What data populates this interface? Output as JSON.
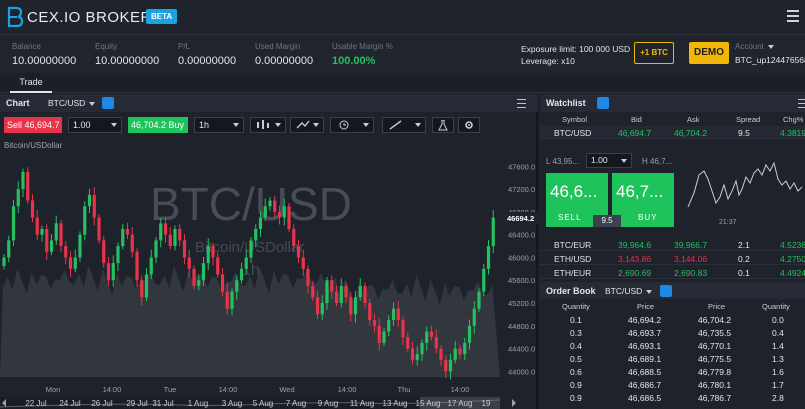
{
  "header": {
    "brand": "CEX.IO BROKER",
    "beta": "BETA"
  },
  "stats": [
    {
      "label": "Balance",
      "value": "10.00000000"
    },
    {
      "label": "Equity",
      "value": "10.00000000"
    },
    {
      "label": "P/L",
      "value": "0.00000000"
    },
    {
      "label": "Used Margin",
      "value": "0.00000000"
    },
    {
      "label": "Usable Margin %",
      "value": "100.00%"
    }
  ],
  "exposure": {
    "limit": "Exposure limit: 100 000 USD",
    "leverage": "Leverage: x10"
  },
  "btn_btc": "+1 BTC",
  "btn_demo": "DEMO",
  "account": {
    "label": "Account",
    "value": "BTC_up124476568"
  },
  "tabs": {
    "trade": "Trade"
  },
  "chart_panel": {
    "title": "Chart",
    "symbol": "BTC/USD",
    "sell": "Sell 46,694.7",
    "qty": "1.00",
    "buy": "46,704.2 Buy",
    "interval": "1h",
    "series_label": "Bitcoin/USDollar",
    "watermark": "BTC/USD",
    "watermark_sub": "Bitcoin/USDollar",
    "watermark_int": "1h"
  },
  "chart_data": {
    "type": "candlestick",
    "title": "BTC/USD",
    "y_ticks": [
      "47600.0",
      "47200.0",
      "46800.0",
      "46400.0",
      "46000.0",
      "45600.0",
      "45200.0",
      "44800.0",
      "44400.0",
      "44000.0"
    ],
    "last_price": "46694.2",
    "time_ticks": [
      "Mon",
      "14:00",
      "Tue",
      "14:00",
      "Wed",
      "14:00",
      "Thu",
      "14:00"
    ],
    "nav_ticks": [
      "22 Jul",
      "24 Jul",
      "26 Jul",
      "29 Jul",
      "31 Jul",
      "1 Aug",
      "3 Aug",
      "5 Aug",
      "7 Aug",
      "9 Aug",
      "11 Aug",
      "13 Aug",
      "15 Aug",
      "17 Aug",
      "19"
    ],
    "ylim": [
      43900,
      47800
    ],
    "closes": [
      46000,
      46300,
      46900,
      47200,
      47500,
      47000,
      46700,
      46400,
      46500,
      46100,
      46300,
      46600,
      46200,
      46000,
      45800,
      46000,
      46400,
      46900,
      47100,
      46700,
      46300,
      45900,
      45600,
      45900,
      46200,
      46500,
      46400,
      46100,
      45600,
      45300,
      45700,
      46000,
      46300,
      46600,
      46400,
      46200,
      46500,
      46300,
      46000,
      45800,
      45500,
      45600,
      45900,
      46200,
      46000,
      45700,
      45400,
      45100,
      45400,
      45600,
      45800,
      46000,
      46300,
      46500,
      46700,
      46900,
      47000,
      46800,
      46700,
      46900,
      46500,
      46200,
      46000,
      45800,
      45500,
      45300,
      45000,
      45200,
      45600,
      45400,
      45200,
      45500,
      45300,
      45000,
      45300,
      45500,
      45200,
      44900,
      44800,
      44500,
      44700,
      44900,
      45100,
      44900,
      44600,
      44400,
      44200,
      44300,
      44500,
      44700,
      44600,
      44400,
      44200,
      44000,
      44200,
      44400,
      44300,
      44500,
      44800,
      45100,
      45400,
      45800,
      46200,
      46700
    ]
  },
  "watchlist": {
    "title": "Watchlist",
    "cols": [
      "Symbol",
      "Bid",
      "Ask",
      "Spread",
      "Chg%"
    ],
    "rows": [
      {
        "symbol": "BTC/USD",
        "bid": "46,694.7",
        "ask": "46,704.2",
        "spread": "9.5",
        "chg": "4.3819"
      },
      {
        "symbol": "BTC/EUR",
        "bid": "39,964.6",
        "ask": "39,966.7",
        "spread": "2.1",
        "chg": "4.5236"
      },
      {
        "symbol": "ETH/USD",
        "bid": "3,143.86",
        "ask": "3,144.06",
        "spread": "0.2",
        "chg": "4.2750"
      },
      {
        "symbol": "ETH/EUR",
        "bid": "2,690.69",
        "ask": "2,690.83",
        "spread": "0.1",
        "chg": "4.4924"
      }
    ],
    "low": "L 43,95...",
    "high": "H 46,7...",
    "qty": "1.00",
    "sell_price": "46,6...",
    "buy_price": "46,7...",
    "sell_label": "SELL",
    "buy_label": "BUY",
    "spread": "9.5",
    "spark_time": "21:37"
  },
  "orderbook": {
    "title": "Order Book",
    "symbol": "BTC/USD",
    "cols": [
      "Quantity",
      "Price",
      "Price",
      "Quantity"
    ],
    "rows": [
      [
        "0.1",
        "46,694.2",
        "46,704.2",
        "0.0"
      ],
      [
        "0.3",
        "46,693.7",
        "46,735.5",
        "0.4"
      ],
      [
        "0.4",
        "46,693.1",
        "46,770.1",
        "1.4"
      ],
      [
        "0.5",
        "46,689.1",
        "46,775.5",
        "1.3"
      ],
      [
        "0.6",
        "46,688.5",
        "46,779.8",
        "1.6"
      ],
      [
        "0.9",
        "46,686.7",
        "46,780.1",
        "1.7"
      ],
      [
        "0.9",
        "46,686.5",
        "46,786.7",
        "2.8"
      ]
    ]
  },
  "colors": {
    "up": "#25c060",
    "down": "#e8344b",
    "accent": "#1e88e5",
    "demo": "#f2b705"
  }
}
